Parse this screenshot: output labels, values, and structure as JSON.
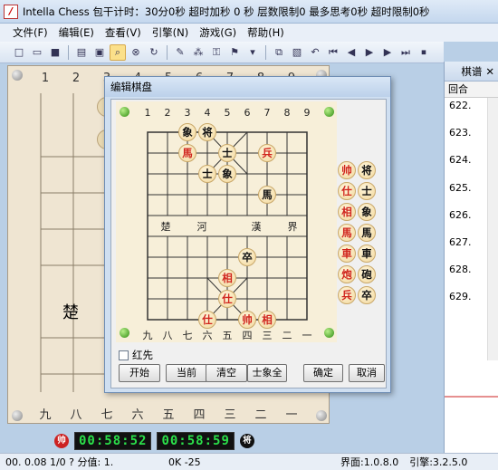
{
  "window": {
    "title": "Intella Chess 包干计时：30分0秒 超时加秒 0 秒 层数限制0 最多思考0秒 超时限制0秒"
  },
  "menu": [
    "文件(F)",
    "编辑(E)",
    "查看(V)",
    "引擎(N)",
    "游戏(G)",
    "帮助(H)"
  ],
  "toolbar_icons": [
    "new-icon",
    "open-icon",
    "save-icon",
    "print-icon",
    "monitor-icon",
    "search-icon",
    "stop-icon",
    "refresh-icon",
    "edit-icon",
    "tree-icon",
    "lock-icon",
    "flag-icon",
    "copy-icon",
    "paste-icon",
    "undo-icon",
    "first-icon",
    "prev-icon",
    "play-icon",
    "next-icon",
    "last-icon",
    "end-icon"
  ],
  "main_board": {
    "top_files": [
      "1",
      "2",
      "3",
      "4",
      "5",
      "6",
      "7",
      "8",
      "9"
    ],
    "bottom_files": [
      "九",
      "八",
      "七",
      "六",
      "五",
      "四",
      "三",
      "二",
      "一"
    ],
    "river_left": "楚"
  },
  "dialog": {
    "title": "编辑棋盘",
    "top_coords": [
      "1",
      "2",
      "3",
      "4",
      "5",
      "6",
      "7",
      "8",
      "9"
    ],
    "bottom_coords": [
      "九",
      "八",
      "七",
      "六",
      "五",
      "四",
      "三",
      "二",
      "一"
    ],
    "river": [
      "楚",
      "河",
      "漢",
      "界"
    ],
    "red_first_label": "红先",
    "buttons": {
      "start": "开始",
      "current": "当前",
      "clear": "清空",
      "all": "士象全",
      "ok": "确定",
      "cancel": "取消"
    },
    "board_pieces": [
      {
        "t": "象",
        "c": "black",
        "f": 2,
        "r": 0
      },
      {
        "t": "将",
        "c": "black",
        "f": 3,
        "r": 0
      },
      {
        "t": "馬",
        "c": "red",
        "f": 2,
        "r": 1
      },
      {
        "t": "士",
        "c": "black",
        "f": 4,
        "r": 1
      },
      {
        "t": "兵",
        "c": "red",
        "f": 6,
        "r": 1
      },
      {
        "t": "士",
        "c": "black",
        "f": 3,
        "r": 2
      },
      {
        "t": "象",
        "c": "black",
        "f": 4,
        "r": 2
      },
      {
        "t": "馬",
        "c": "black",
        "f": 6,
        "r": 3
      },
      {
        "t": "卒",
        "c": "black",
        "f": 5,
        "r": 6
      },
      {
        "t": "相",
        "c": "red",
        "f": 4,
        "r": 7
      },
      {
        "t": "仕",
        "c": "red",
        "f": 4,
        "r": 8
      },
      {
        "t": "仕",
        "c": "red",
        "f": 3,
        "r": 9
      },
      {
        "t": "帅",
        "c": "red",
        "f": 5,
        "r": 9
      },
      {
        "t": "相",
        "c": "red",
        "f": 6,
        "r": 9
      }
    ],
    "side_pieces": [
      {
        "t": "帅",
        "c": "red"
      },
      {
        "t": "将",
        "c": "black"
      },
      {
        "t": "仕",
        "c": "red"
      },
      {
        "t": "士",
        "c": "black"
      },
      {
        "t": "相",
        "c": "red"
      },
      {
        "t": "象",
        "c": "black"
      },
      {
        "t": "馬",
        "c": "red"
      },
      {
        "t": "馬",
        "c": "black"
      },
      {
        "t": "車",
        "c": "red"
      },
      {
        "t": "車",
        "c": "black"
      },
      {
        "t": "炮",
        "c": "red"
      },
      {
        "t": "砲",
        "c": "black"
      },
      {
        "t": "兵",
        "c": "red"
      },
      {
        "t": "卒",
        "c": "black"
      }
    ]
  },
  "right_panel": {
    "tab_label": "棋谱",
    "column_header": "回合",
    "moves": [
      "622.",
      "623.",
      "624.",
      "625.",
      "626.",
      "627.",
      "628.",
      "629."
    ]
  },
  "clocks": {
    "red_mark": "帅",
    "red_time": "00:58:52",
    "black_time": "00:58:59",
    "black_mark": "将"
  },
  "status": {
    "left": "00.   0.08 1/0 ?  分值:  1.",
    "mid": "0K -25",
    "ui_version": "界面:1.0.8.0",
    "engine_version": "引擎:3.2.5.0"
  },
  "colors": {
    "red_piece": "#d0241c",
    "black_piece": "#111111",
    "clock_digits": "#2be04a"
  }
}
